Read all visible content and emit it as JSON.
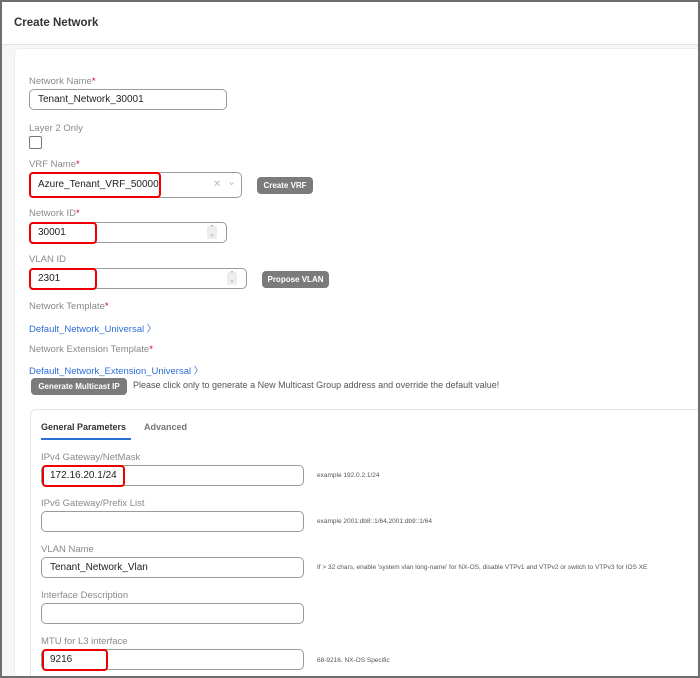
{
  "header": {
    "title": "Create Network"
  },
  "form": {
    "network_name": {
      "label": "Network Name",
      "required": "*",
      "value": "Tenant_Network_30001"
    },
    "layer2_only": {
      "label": "Layer 2 Only",
      "checked": false
    },
    "vrf_name": {
      "label": "VRF Name",
      "required": "*",
      "value": "Azure_Tenant_VRF_50000",
      "clear_icon": "✕",
      "chevron_icon": "⌄",
      "create_button": "Create VRF"
    },
    "network_id": {
      "label": "Network ID",
      "required": "*",
      "value": "30001"
    },
    "vlan_id": {
      "label": "VLAN ID",
      "value": "2301",
      "propose_button": "Propose VLAN"
    },
    "network_template": {
      "label": "Network Template",
      "required": "*",
      "value": "Default_Network_Universal"
    },
    "extension_template": {
      "label": "Network Extension Template",
      "required": "*",
      "value": "Default_Network_Extension_Universal"
    },
    "multicast": {
      "button": "Generate Multicast IP",
      "note": "Please click only to generate a New Multicast Group address and override the default value!"
    }
  },
  "tabs": [
    {
      "label": "General Parameters",
      "active": true
    },
    {
      "label": "Advanced",
      "active": false
    }
  ],
  "general": {
    "ipv4": {
      "label": "IPv4 Gateway/NetMask",
      "value": "172.16.20.1/24",
      "hint": "example 192.0.2.1/24"
    },
    "ipv6": {
      "label": "IPv6 Gateway/Prefix List",
      "value": "",
      "hint": "example 2001:db8::1/64,2001:db9::1/64"
    },
    "vlan_name": {
      "label": "VLAN Name",
      "value": "Tenant_Network_Vlan",
      "hint": "If > 32 chars, enable 'system vlan long-name' for NX-OS, disable VTPv1 and VTPv2 or switch to VTPv3 for IOS XE"
    },
    "intf_desc": {
      "label": "Interface Description",
      "value": ""
    },
    "mtu": {
      "label": "MTU for L3 interface",
      "value": "9216",
      "hint": "68-9216. NX-OS Specific"
    }
  },
  "colors": {
    "highlight": "#ee0000",
    "link": "#2b6fd6",
    "button": "#7b7b7b",
    "tab_underline": "#2b6fd6"
  }
}
